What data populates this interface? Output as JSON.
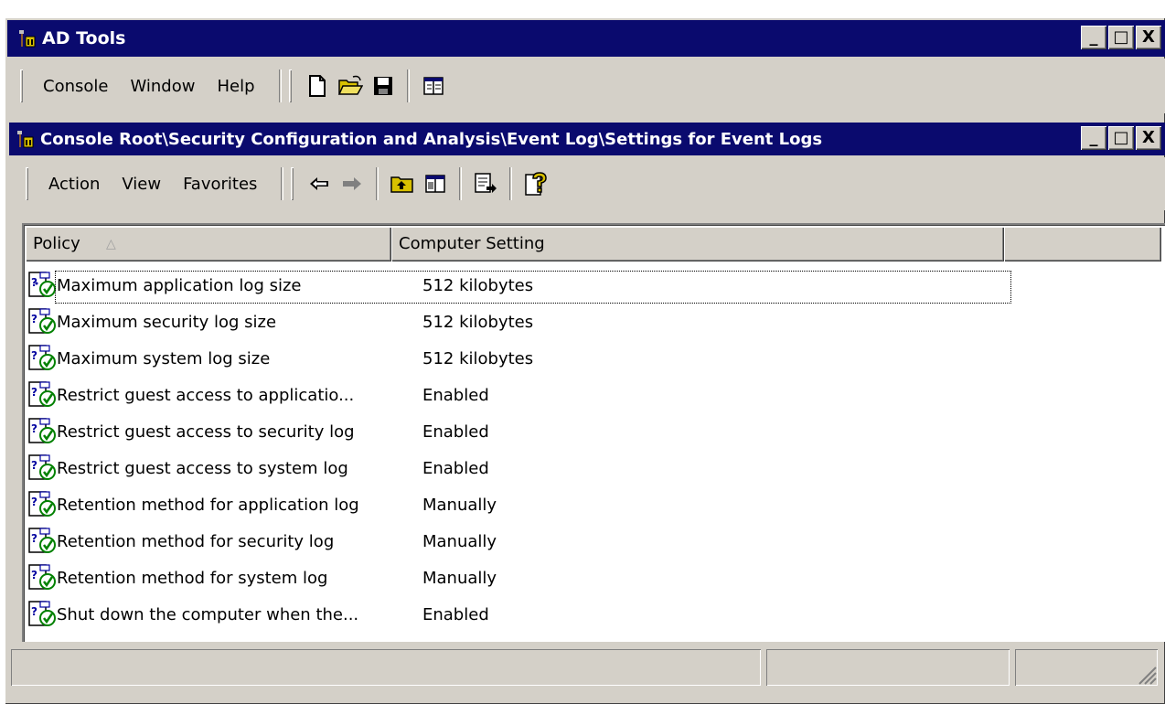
{
  "app": {
    "title": "AD Tools",
    "menu": [
      "Console",
      "Window",
      "Help"
    ],
    "window_buttons": [
      "_",
      "□",
      "X"
    ],
    "toolbar_icons": [
      "new-document-icon",
      "open-folder-icon",
      "save-icon",
      "show-hide-console-tree-icon"
    ]
  },
  "child_window": {
    "title": "Console Root\\Security Configuration and Analysis\\Event Log\\Settings for Event Logs",
    "menu": [
      "Action",
      "View",
      "Favorites"
    ],
    "window_buttons": [
      "_",
      "□",
      "X"
    ],
    "toolbar_icons": [
      "back-arrow-icon",
      "forward-arrow-icon",
      "up-one-level-icon",
      "show-hide-tree-icon",
      "export-list-icon",
      "help-icon"
    ]
  },
  "list": {
    "columns": [
      "Policy",
      "Computer Setting"
    ],
    "sort_column": "Policy",
    "rows": [
      {
        "policy": "Maximum application log size",
        "setting": "512 kilobytes"
      },
      {
        "policy": "Maximum security log size",
        "setting": "512 kilobytes"
      },
      {
        "policy": "Maximum system log size",
        "setting": "512 kilobytes"
      },
      {
        "policy": "Restrict guest access to applicatio...",
        "setting": "Enabled"
      },
      {
        "policy": "Restrict guest access to security log",
        "setting": "Enabled"
      },
      {
        "policy": "Restrict guest access to system log",
        "setting": "Enabled"
      },
      {
        "policy": "Retention method for application log",
        "setting": "Manually"
      },
      {
        "policy": "Retention method for security log",
        "setting": "Manually"
      },
      {
        "policy": "Retention method for system log",
        "setting": "Manually"
      },
      {
        "policy": "Shut down the computer when the...",
        "setting": "Enabled"
      }
    ]
  },
  "colors": {
    "title_bar": "#0a0a6e",
    "chrome": "#d4d0c8",
    "icon_green": "#008000",
    "icon_blue": "#0000a0",
    "folder_yellow": "#d8c000"
  }
}
